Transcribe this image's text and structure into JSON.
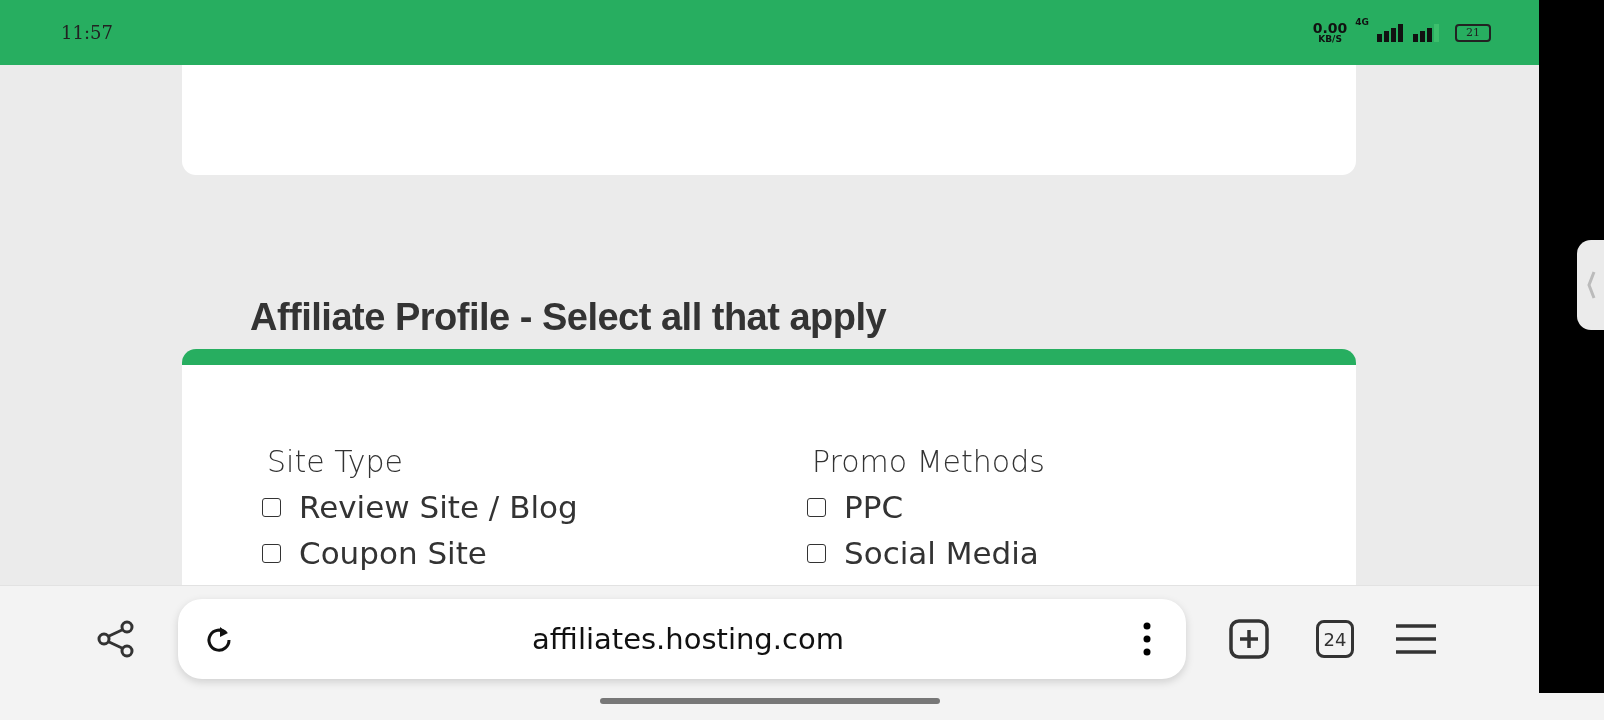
{
  "status_bar": {
    "time": "11:57",
    "speed": "0.00",
    "speed_unit": "KB/S",
    "network": "4G",
    "battery": "21"
  },
  "section": {
    "title": "Affiliate Profile - Select all that apply",
    "groups": [
      {
        "label": "Site Type",
        "options": [
          {
            "label": "Review Site / Blog",
            "checked": false
          },
          {
            "label": "Coupon Site",
            "checked": false
          }
        ]
      },
      {
        "label": "Promo Methods",
        "options": [
          {
            "label": "PPC",
            "checked": false
          },
          {
            "label": "Social Media",
            "checked": false
          }
        ]
      }
    ]
  },
  "browser_bar": {
    "url": "affiliates.hosting.com",
    "tab_count": "24"
  }
}
